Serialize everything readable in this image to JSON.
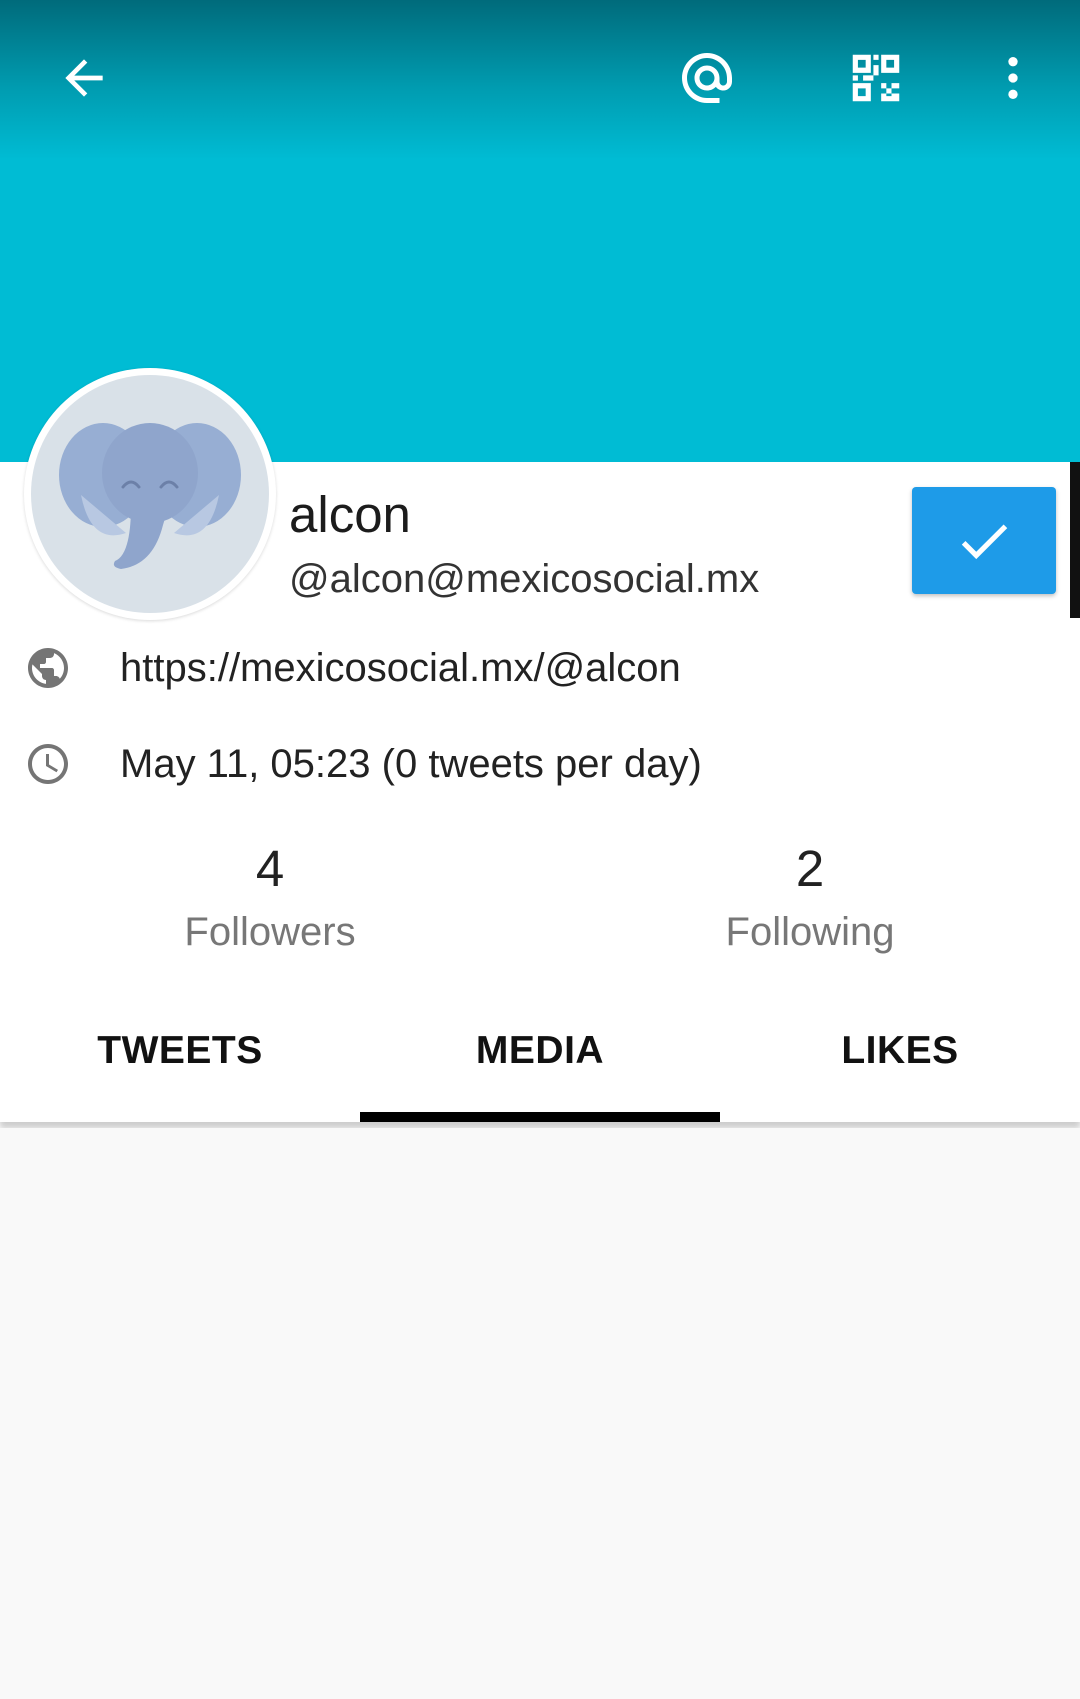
{
  "colors": {
    "header_bg": "#00bcd4",
    "follow_button": "#1e9be8",
    "card_bg": "#ffffff",
    "content_bg": "#f9f9f9"
  },
  "toolbar": {
    "back_icon": "arrow-left-icon",
    "mention_icon": "at-sign-icon",
    "qr_icon": "qr-code-icon",
    "more_icon": "more-vertical-icon"
  },
  "profile": {
    "display_name": "alcon",
    "handle": "@alcon@mexicosocial.mx",
    "avatar_icon": "elephant-avatar-icon",
    "follow_state_icon": "check-icon",
    "website": "https://mexicosocial.mx/@alcon",
    "joined": "May 11, 05:23 (0 tweets per day)"
  },
  "stats": {
    "followers_count": "4",
    "followers_label": "Followers",
    "following_count": "2",
    "following_label": "Following"
  },
  "tabs": [
    {
      "label": "TWEETS",
      "active": false
    },
    {
      "label": "MEDIA",
      "active": true
    },
    {
      "label": "LIKES",
      "active": false
    }
  ]
}
